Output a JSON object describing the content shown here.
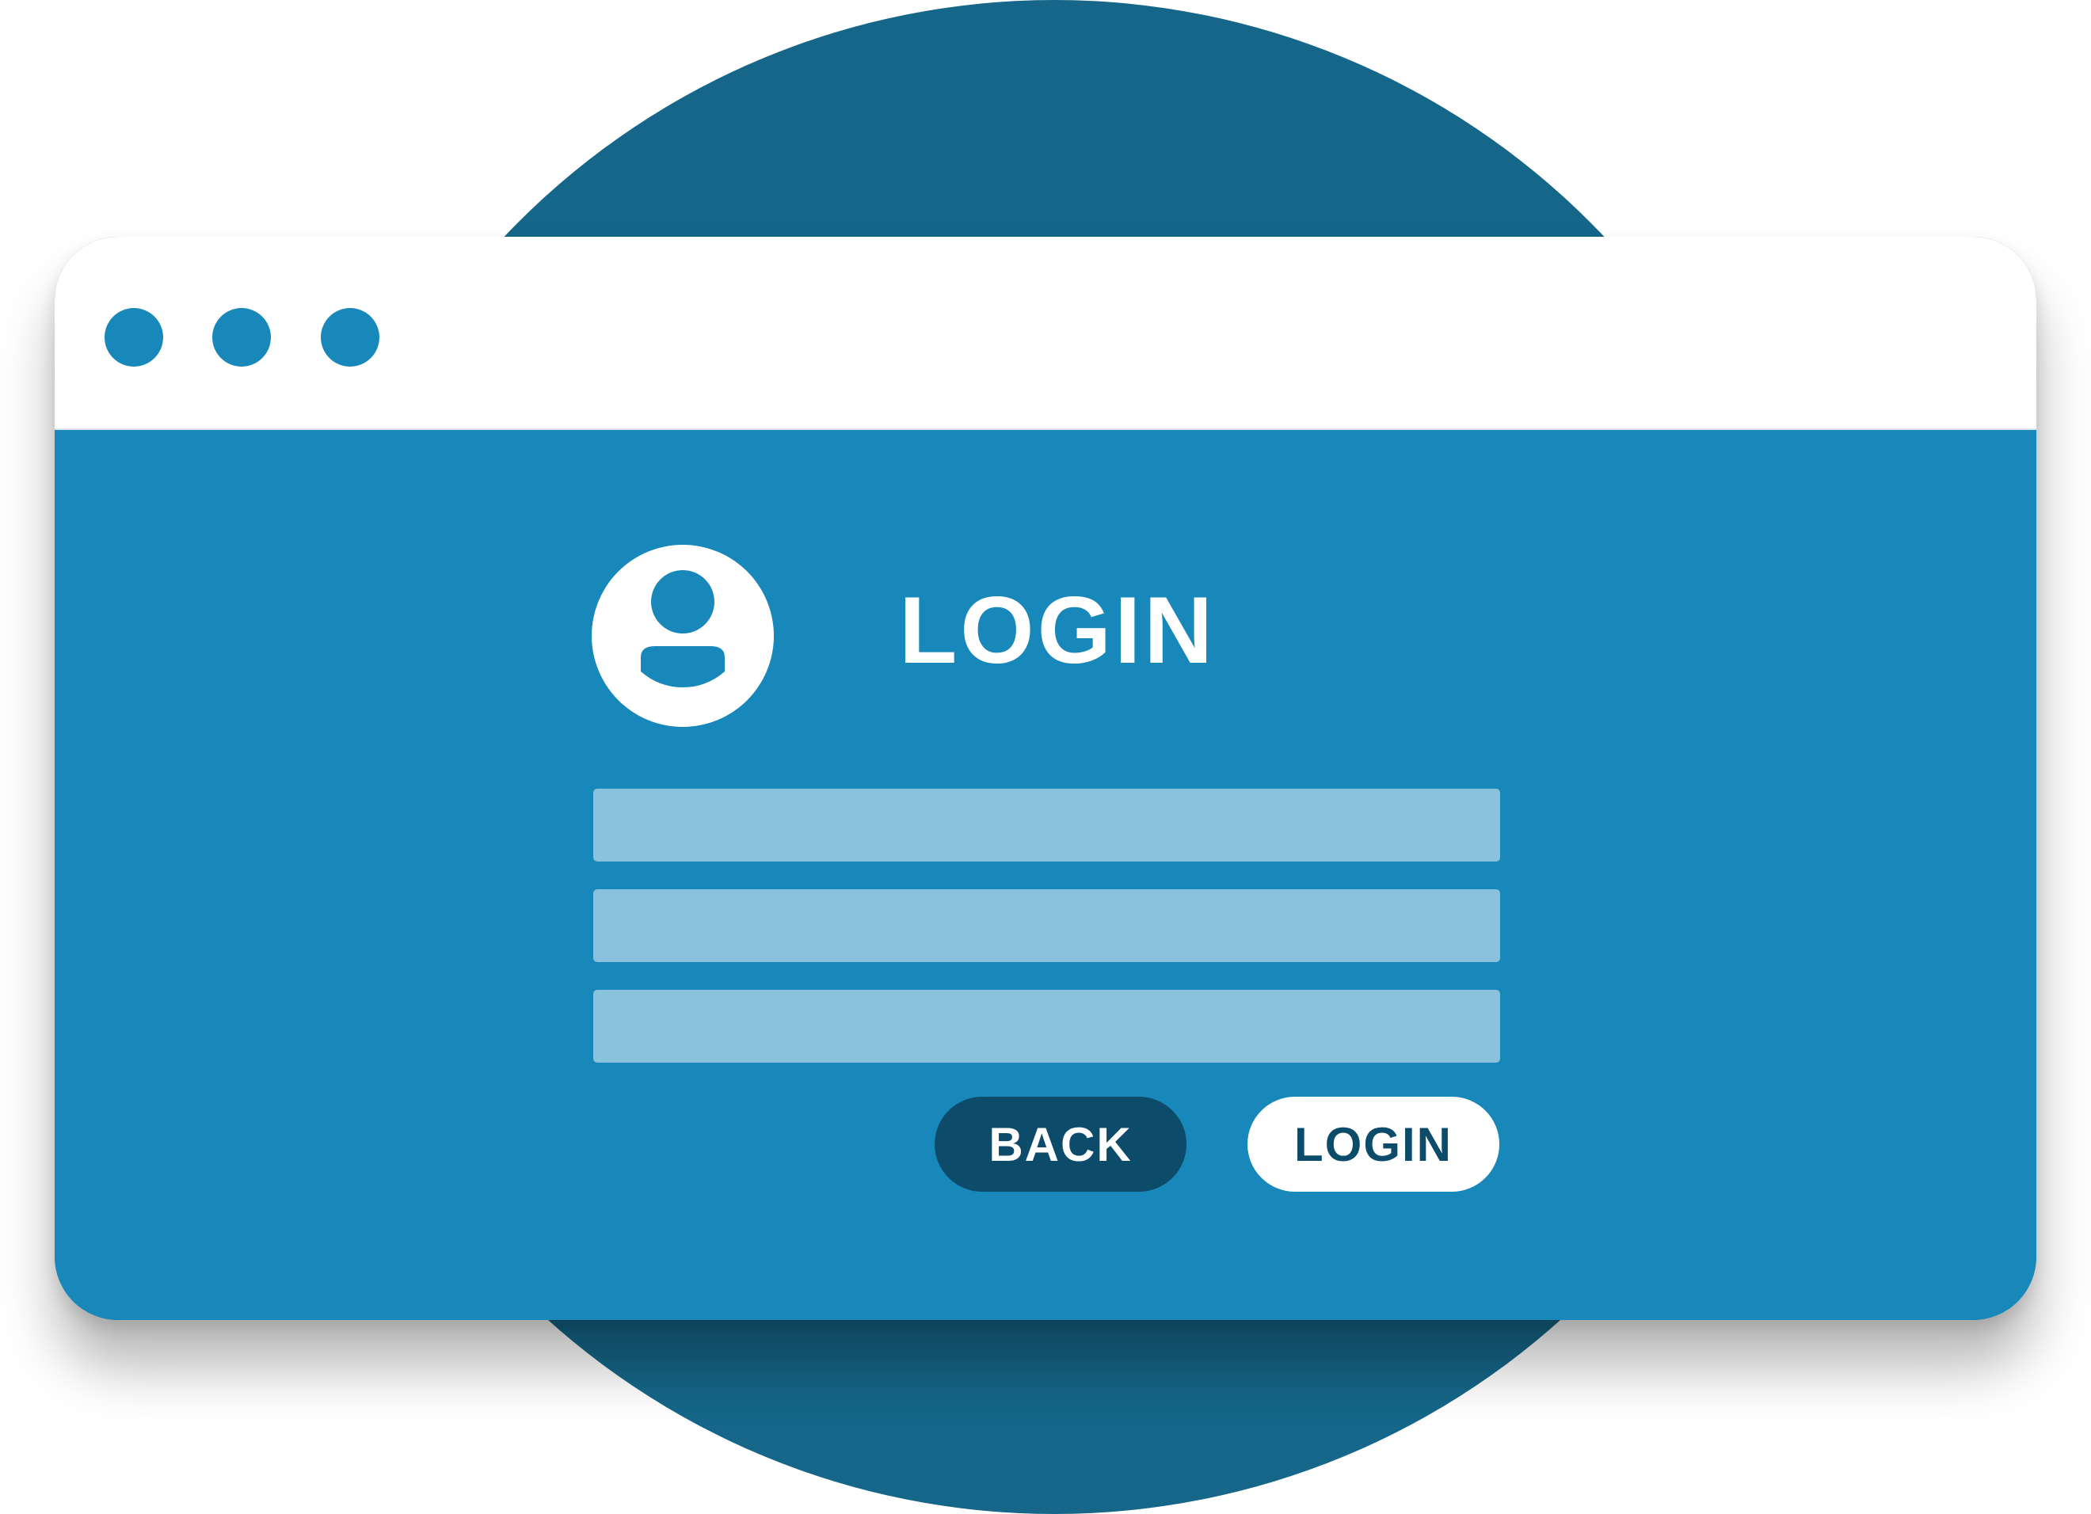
{
  "colors": {
    "background_circle": "#156688",
    "window_body": "#1788b9",
    "titlebar": "#ffffff",
    "window_dots": "#1788b9",
    "input_fields": "#8ac1dc",
    "back_button": "#0d4b6a",
    "login_button": "#ffffff"
  },
  "window": {
    "titlebar": {
      "dots": [
        "window-dot",
        "window-dot",
        "window-dot"
      ]
    }
  },
  "login_form": {
    "avatar_icon": "user-avatar-icon",
    "title": "LOGIN",
    "fields": [
      {
        "value": "",
        "placeholder": ""
      },
      {
        "value": "",
        "placeholder": ""
      },
      {
        "value": "",
        "placeholder": ""
      }
    ],
    "back_label": "BACK",
    "login_label": "LOGIN"
  }
}
